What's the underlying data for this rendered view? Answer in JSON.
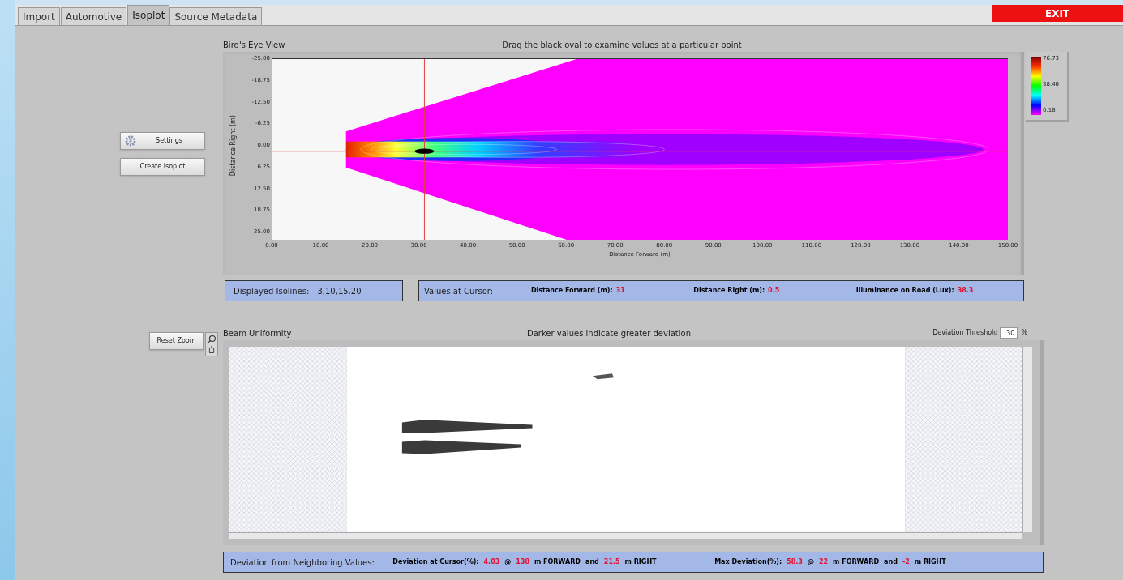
{
  "tabs": [
    {
      "label": "Import",
      "selected": false
    },
    {
      "label": "Automotive",
      "selected": false
    },
    {
      "label": "Isoplot",
      "selected": true
    },
    {
      "label": "Source Metadata",
      "selected": false
    }
  ],
  "exit_button": "EXIT",
  "birds_eye": {
    "title": "Bird's Eye View",
    "subtitle": "Drag the black oval to examine values at a particular point",
    "ylabel": "Distance Right (m)",
    "xlabel": "Distance Forward (m)",
    "yticks": [
      "-25.00",
      "-18.75",
      "-12.50",
      "-6.25",
      "0.00",
      "6.25",
      "12.50",
      "18.75",
      "25.00"
    ],
    "xticks": [
      "0.00",
      "10.00",
      "20.00",
      "30.00",
      "40.00",
      "50.00",
      "60.00",
      "70.00",
      "80.00",
      "90.00",
      "100.00",
      "110.00",
      "120.00",
      "130.00",
      "140.00",
      "150.00"
    ],
    "colorbar_ticks": [
      "76.73",
      "38.46",
      "0.18"
    ]
  },
  "buttons": [
    "Settings",
    "Create Isoplot"
  ],
  "isolines": {
    "label": "Displayed Isolines:",
    "value": "3,10,15,20"
  },
  "cursor_values": {
    "label": "Values at Cursor:",
    "items": [
      {
        "label": "Distance Forward (m):",
        "value": "31"
      },
      {
        "label": "Distance Right (m):",
        "value": "0.5"
      },
      {
        "label": "Illuminance on Road (Lux):",
        "value": "38.3"
      }
    ]
  },
  "beam_uniformity": {
    "title": "Beam Uniformity",
    "subtitle": "Darker values indicate greater deviation",
    "reset_button": "Reset Zoom",
    "threshold_label": "Deviation Threshold",
    "threshold_value": "30",
    "threshold_unit": "%"
  },
  "deviation_bar": {
    "label": "Deviation from Neighboring Values:",
    "groups": [
      {
        "segments": [
          {
            "kind": "label",
            "text": "Deviation at Cursor(%):"
          },
          {
            "kind": "value",
            "text": "4.03"
          },
          {
            "kind": "text",
            "text": "@"
          },
          {
            "kind": "value",
            "text": "138"
          },
          {
            "kind": "text",
            "text": "m FORWARD"
          },
          {
            "kind": "text",
            "text": "and"
          },
          {
            "kind": "value",
            "text": "21.5"
          },
          {
            "kind": "text",
            "text": "m RIGHT"
          }
        ]
      },
      {
        "segments": [
          {
            "kind": "label",
            "text": "Max Deviation(%):"
          },
          {
            "kind": "value",
            "text": "58.3"
          },
          {
            "kind": "text",
            "text": "@"
          },
          {
            "kind": "value",
            "text": "22"
          },
          {
            "kind": "text",
            "text": "m FORWARD"
          },
          {
            "kind": "text",
            "text": "and"
          },
          {
            "kind": "value",
            "text": "-2"
          },
          {
            "kind": "text",
            "text": "m RIGHT"
          }
        ]
      }
    ]
  }
}
